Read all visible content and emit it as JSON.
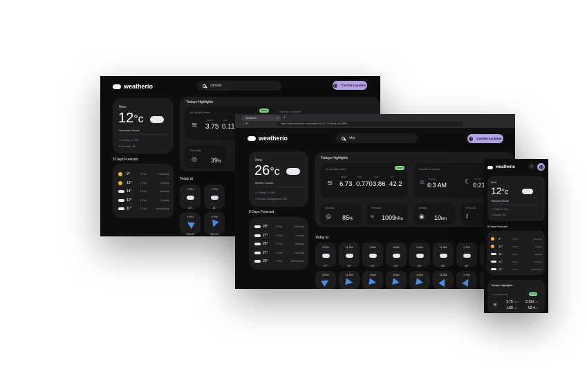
{
  "back": {
    "logo": "weatherio",
    "search_value": "canada",
    "location_button": "Current Location",
    "now_label": "Now",
    "temp": "12",
    "unit": "°c",
    "condition": "Overcast Clouds",
    "date": "Friday 3, Feb",
    "place": "Canada, BC",
    "forecast_title": "5 Days Forecast",
    "forecast": [
      {
        "temp": "9°",
        "date": "3 Feb",
        "day": "Saturday",
        "icon": "sun"
      },
      {
        "temp": "12°",
        "date": "4 Feb",
        "day": "Sunday",
        "icon": "sun"
      },
      {
        "temp": "14°",
        "date": "5 Feb",
        "day": "Monday",
        "icon": "cloud"
      },
      {
        "temp": "12°",
        "date": "6 Feb",
        "day": "Tuesday",
        "icon": "cloud"
      },
      {
        "temp": "11°",
        "date": "7 Feb",
        "day": "Wednesday",
        "icon": "cloud"
      }
    ],
    "highlights_title": "Todays Highlights",
    "aqi_label": "Air Quality Index",
    "aqi_badge": "Good",
    "sun_label": "Sunrise & Sunset",
    "pm_label": "PM2.5",
    "so2_label": "SO2",
    "pm_value": "3.75",
    "so2_value": "0.110",
    "humidity_label": "Humidity",
    "humidity_value": "39",
    "humidity_unit": "%",
    "today_label": "Today at",
    "hours": [
      {
        "time": "1 PM",
        "temp": "12°",
        "speed": "4 km/h"
      },
      {
        "time": "4 PM",
        "temp": "14°",
        "speed": "3 km/h"
      }
    ]
  },
  "browser": {
    "tab_title": "Weatherio",
    "url": "https://www.weatherio.io/#/weather?lat=23.7644&lon=90.3890",
    "logo": "weatherio",
    "search_value": "dha",
    "location_button": "Current Location",
    "now_label": "Now",
    "temp": "26",
    "unit": "°c",
    "condition": "Broken Clouds",
    "date": "Friday 3, Feb",
    "place": "Dhaka, Bangladesh, BD",
    "forecast_title": "5 Days Forecast",
    "forecast": [
      {
        "temp": "28°",
        "date": "3 Feb",
        "day": "Saturday"
      },
      {
        "temp": "27°",
        "date": "4 Feb",
        "day": "Sunday"
      },
      {
        "temp": "26°",
        "date": "5 Feb",
        "day": "Monday"
      },
      {
        "temp": "27°",
        "date": "6 Feb",
        "day": "Tuesday"
      },
      {
        "temp": "26°",
        "date": "7 Feb",
        "day": "Wednesday"
      }
    ],
    "highlights_title": "Todays Highlights",
    "aqi_label": "Air Quality Index",
    "aqi_badge": "Good",
    "pollutants": [
      {
        "label": "PM2.5",
        "value": "6.73"
      },
      {
        "label": "SO2",
        "value": "0.770"
      },
      {
        "label": "NO2",
        "value": "3.86"
      },
      {
        "label": "O3",
        "value": "42.2"
      }
    ],
    "sun_label": "Sunrise & Sunset",
    "sunrise_label": "Sunrise",
    "sunrise_value": "6:3 AM",
    "sunset_label": "Sunset",
    "sunset_value": "6:21 PM",
    "humidity_label": "Humidity",
    "humidity_value": "85",
    "humidity_unit": "%",
    "pressure_label": "Pressure",
    "pressure_value": "1009",
    "pressure_unit": "hPa",
    "visibility_label": "Visibility",
    "visibility_value": "10",
    "visibility_unit": "km",
    "feels_label": "Feels Like",
    "feels_value": "2",
    "today_label": "Today at",
    "hours": [
      {
        "time": "8 PM",
        "temp": "27°"
      },
      {
        "time": "11 PM",
        "temp": "19°"
      },
      {
        "time": "2 AM",
        "temp": "20°"
      },
      {
        "time": "5 AM",
        "temp": "22°"
      },
      {
        "time": "8 AM",
        "temp": "24°"
      },
      {
        "time": "11 AM",
        "temp": "31°"
      },
      {
        "time": "2 PM",
        "temp": "32°"
      },
      {
        "time": "5 PM",
        "temp": ""
      }
    ]
  },
  "mobile": {
    "logo": "weatherio",
    "now_label": "Now",
    "temp": "12",
    "unit": "°c",
    "condition": "Overcast Clouds",
    "date": "Friday 3, Feb",
    "place": "Canada, BC",
    "forecast_title": "5 Days Forecast",
    "forecast": [
      {
        "temp": "9°",
        "date": "3 Feb",
        "day": "Saturday",
        "icon": "sun"
      },
      {
        "temp": "12°",
        "date": "4 Feb",
        "day": "Sunday",
        "icon": "sun"
      },
      {
        "temp": "14°",
        "date": "5 Feb",
        "day": "Monday",
        "icon": "cloud"
      },
      {
        "temp": "12°",
        "date": "6 Feb",
        "day": "Tuesday",
        "icon": "cloud"
      },
      {
        "temp": "11°",
        "date": "7 Feb",
        "day": "Wednesday",
        "icon": "cloud"
      }
    ],
    "highlights_title": "Todays Highlights",
    "aqi_label": "Air Quality Index",
    "aqi_badge": "Good",
    "pm_value": "3.75",
    "pm_label": "PM2.5",
    "so2_value": "0.110",
    "so2_label": "SO2",
    "no2_value": "1.89",
    "no2_label": "NO2",
    "o3_value": "59.4",
    "o3_label": "O3"
  },
  "colors": {
    "accent": "#b5a1e5",
    "good": "#89e396",
    "bg": "#0d0d0e",
    "card": "#1d1c1f"
  }
}
